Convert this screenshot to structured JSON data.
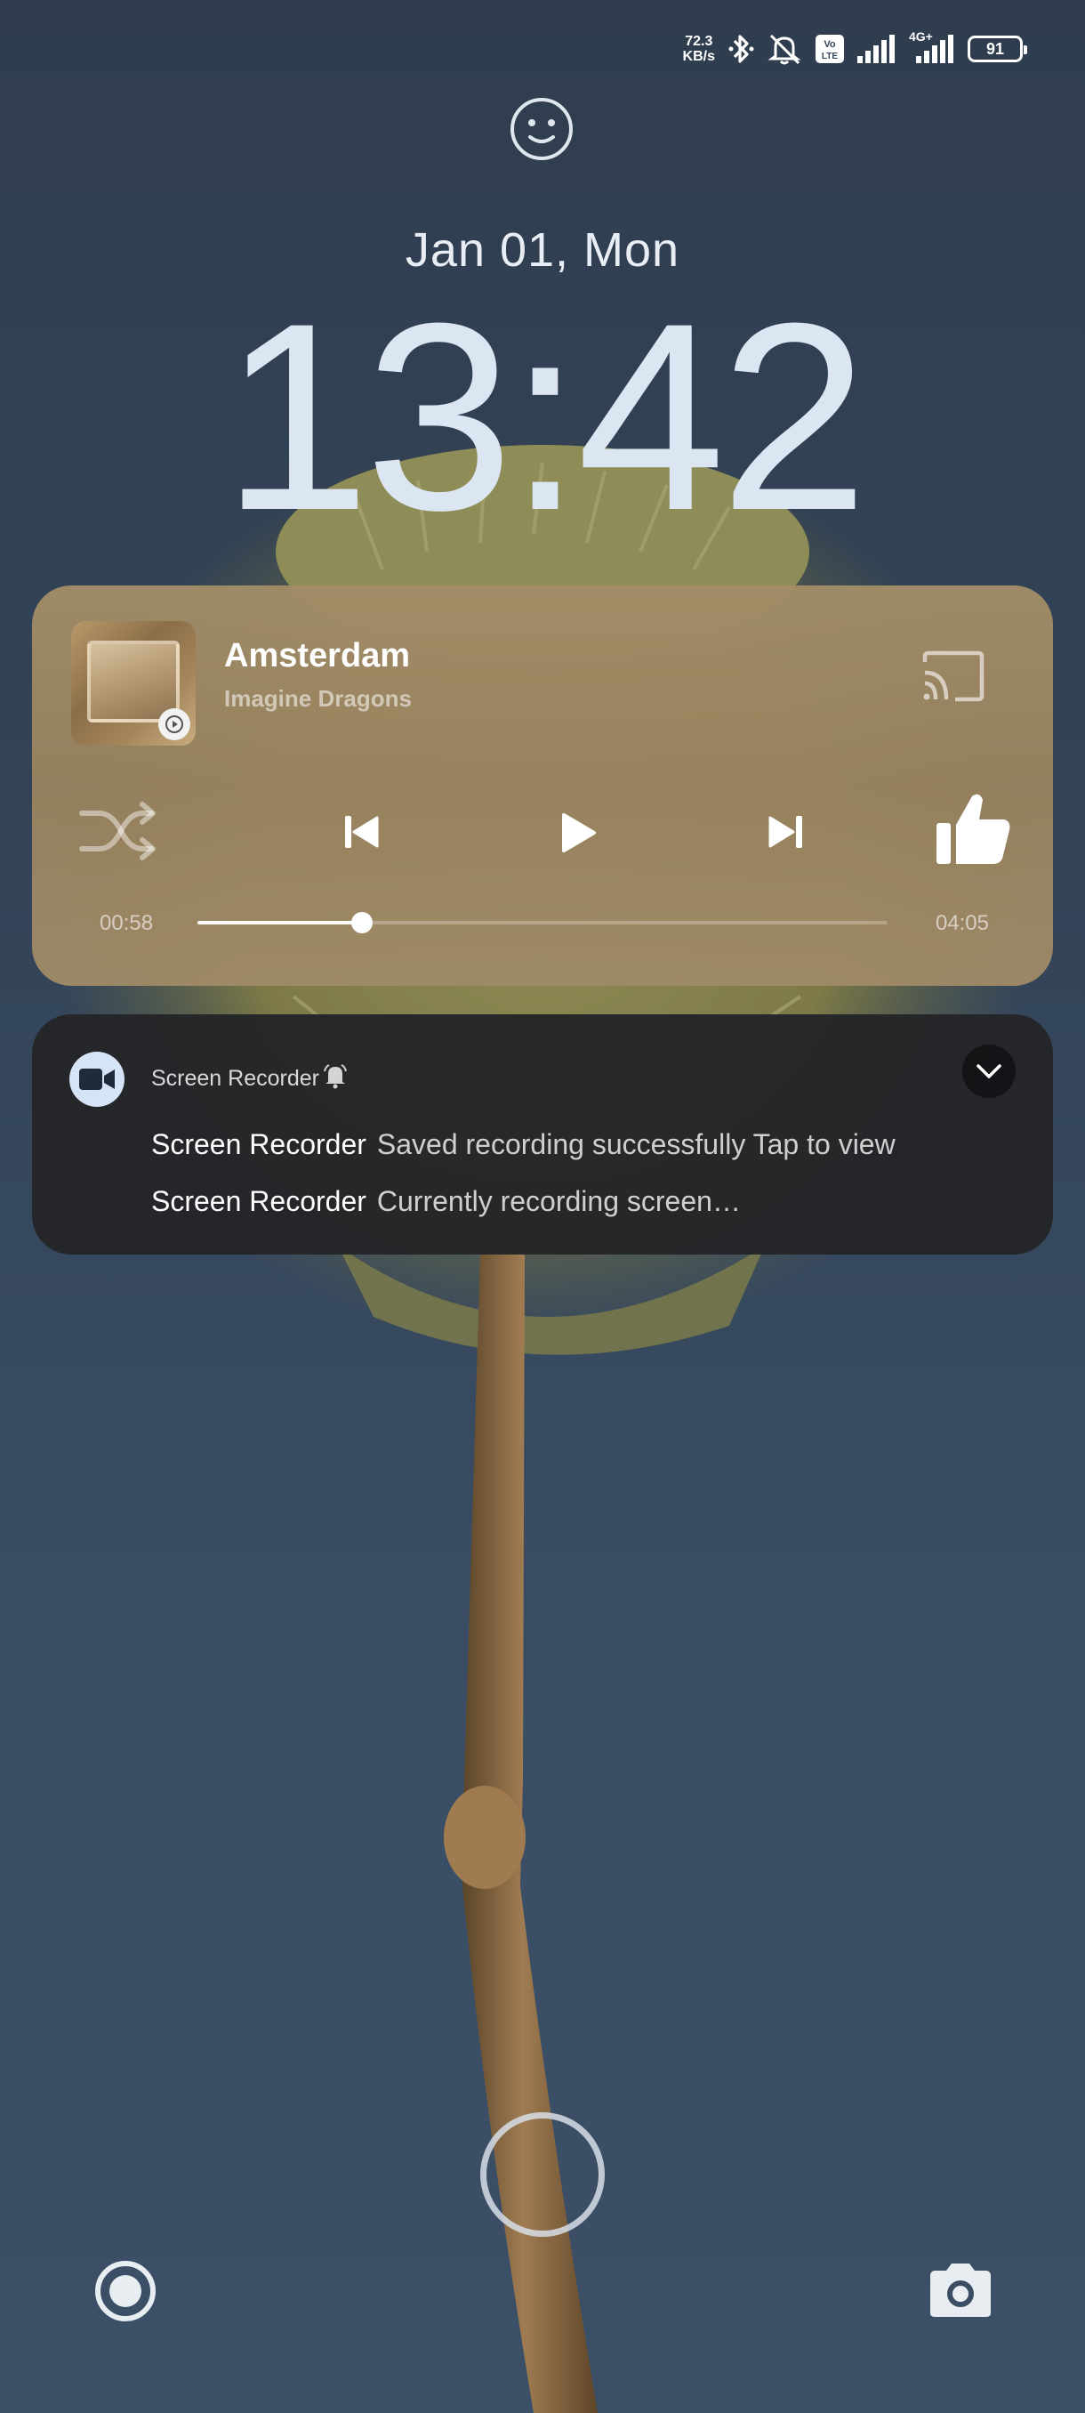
{
  "status_bar": {
    "net_speed_value": "72.3",
    "net_speed_unit": "KB/s",
    "volte_label": "Vo LTE",
    "network_type": "4G+",
    "battery_level": "91"
  },
  "lockscreen": {
    "date": "Jan 01, Mon",
    "time": "13:42"
  },
  "media_player": {
    "title": "Amsterdam",
    "artist": "Imagine Dragons",
    "elapsed": "00:58",
    "duration": "04:05",
    "progress_fraction": 0.239
  },
  "notification": {
    "app_name": "Screen Recorder",
    "lines": [
      {
        "sender": "Screen Recorder",
        "text": "Saved recording successfully Tap to view"
      },
      {
        "sender": "Screen Recorder",
        "text": "Currently recording screen…"
      }
    ]
  },
  "colors": {
    "background": "#34455a",
    "media_card": "#9c8460",
    "notification_bg": "#242528",
    "clock": "#dbe6f2"
  },
  "icons": {
    "bluetooth": "bluetooth-icon",
    "alarm_off": "alarm-off-icon",
    "cast": "cast-icon",
    "shuffle": "shuffle-icon",
    "like": "thumbs-up-icon",
    "record": "record-icon",
    "camera": "camera-icon"
  }
}
